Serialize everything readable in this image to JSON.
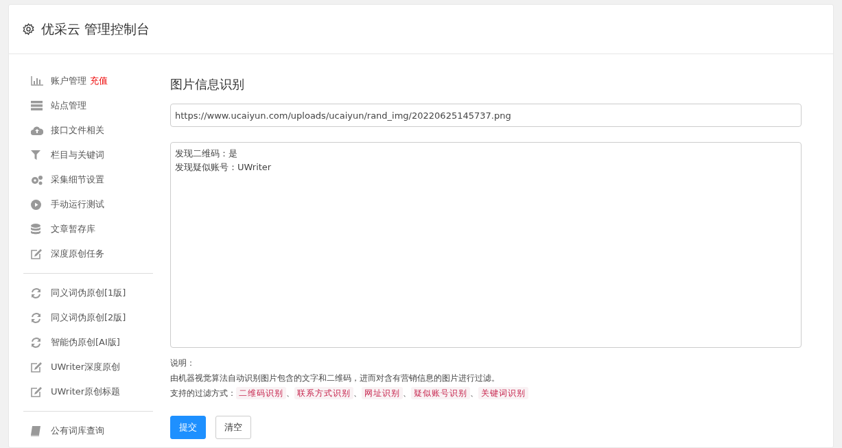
{
  "header": {
    "title": "优采云 管理控制台"
  },
  "sidebar": {
    "groups": [
      [
        {
          "label": "账户管理",
          "badge": "充值"
        },
        {
          "label": "站点管理"
        },
        {
          "label": "接口文件相关"
        },
        {
          "label": "栏目与关键词"
        },
        {
          "label": "采集细节设置"
        },
        {
          "label": "手动运行测试"
        },
        {
          "label": "文章暂存库"
        },
        {
          "label": "深度原创任务"
        }
      ],
      [
        {
          "label": "同义词伪原创[1版]"
        },
        {
          "label": "同义词伪原创[2版]"
        },
        {
          "label": "智能伪原创[AI版]"
        },
        {
          "label": "UWriter深度原创"
        },
        {
          "label": "UWriter原创标题"
        }
      ],
      [
        {
          "label": "公有词库查询"
        }
      ]
    ]
  },
  "main": {
    "title": "图片信息识别",
    "url_field": {
      "value": "https://www.ucaiyun.com/uploads/ucaiyun/rand_img/20220625145737.png"
    },
    "result_box": {
      "lines": [
        "发现二维码：是",
        "发现疑似账号：UWriter"
      ]
    },
    "notes": {
      "heading": "说明：",
      "description": "由机器视觉算法自动识别图片包含的文字和二维码，进而对含有营销信息的图片进行过滤。",
      "filters_label": "支持的过滤方式：",
      "filters": [
        {
          "label": "二维码识别",
          "separator": "、"
        },
        {
          "label": "联系方式识别",
          "separator": "、"
        },
        {
          "label": "网址识别",
          "separator": "、"
        },
        {
          "label": "疑似账号识别",
          "separator": "、"
        },
        {
          "label": "关键词识别"
        }
      ]
    },
    "buttons": [
      {
        "label": "提交",
        "kind": "primary"
      },
      {
        "label": "清空",
        "kind": "default"
      }
    ]
  }
}
